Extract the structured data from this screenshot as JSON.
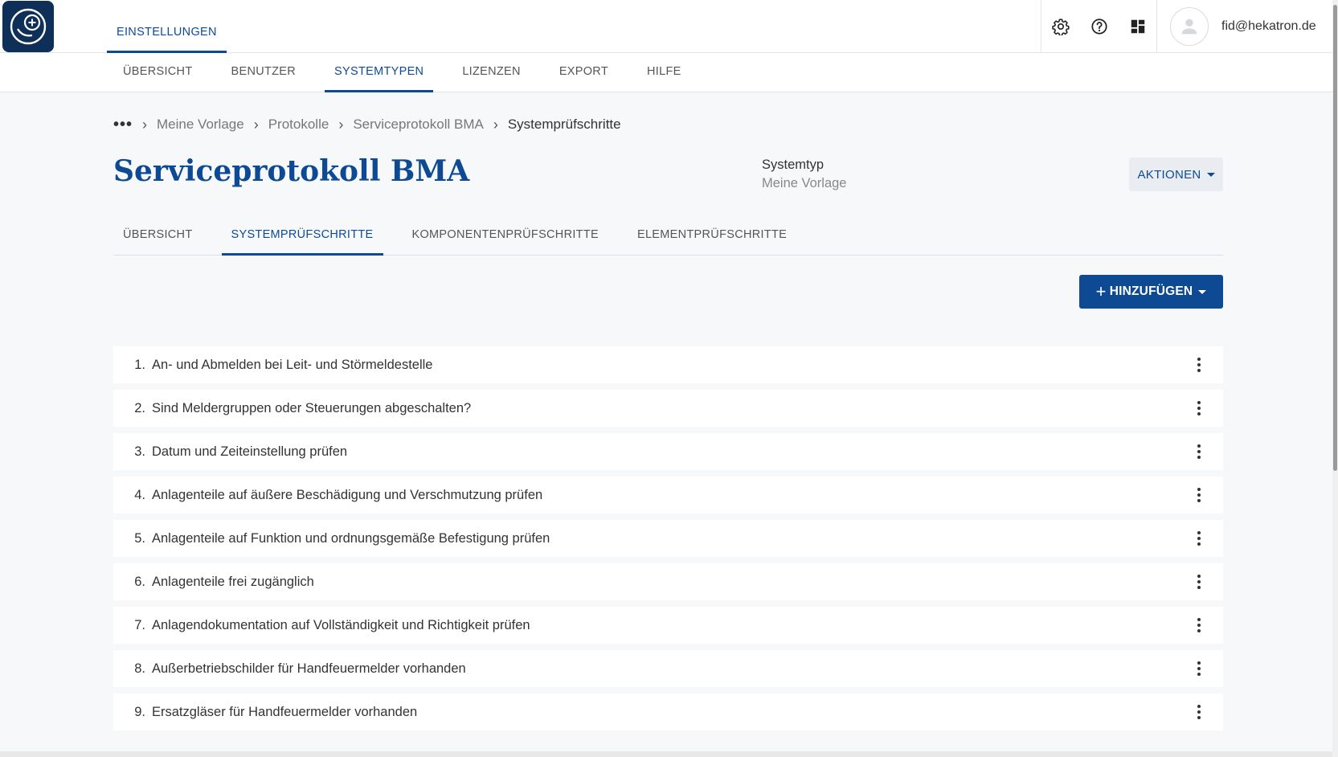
{
  "header": {
    "main_tab": "EINSTELLUNGEN",
    "user_email": "fid@hekatron.de"
  },
  "subnav": {
    "tabs": [
      "ÜBERSICHT",
      "BENUTZER",
      "SYSTEMTYPEN",
      "LIZENZEN",
      "EXPORT",
      "HILFE"
    ],
    "active": "SYSTEMTYPEN"
  },
  "breadcrumb": {
    "items": [
      "Meine Vorlage",
      "Protokolle",
      "Serviceprotokoll BMA"
    ],
    "current": "Systemprüfschritte"
  },
  "page": {
    "title": "Serviceprotokoll BMA",
    "meta_label": "Systemtyp",
    "meta_value": "Meine Vorlage",
    "actions_label": "AKTIONEN",
    "add_label": "HINZUFÜGEN"
  },
  "inner_tabs": {
    "tabs": [
      "ÜBERSICHT",
      "SYSTEMPRÜFSCHRITTE",
      "KOMPONENTENPRÜFSCHRITTE",
      "ELEMENTPRÜFSCHRITTE"
    ],
    "active": "SYSTEMPRÜFSCHRITTE"
  },
  "steps": [
    {
      "num": "1.",
      "text": "An- und Abmelden bei Leit- und Störmeldestelle"
    },
    {
      "num": "2.",
      "text": "Sind Meldergruppen oder Steuerungen abgeschalten?"
    },
    {
      "num": "3.",
      "text": "Datum und Zeiteinstellung prüfen"
    },
    {
      "num": "4.",
      "text": "Anlagenteile auf äußere Beschädigung und Verschmutzung prüfen"
    },
    {
      "num": "5.",
      "text": "Anlagenteile auf Funktion und ordnungsgemäße Befestigung prüfen"
    },
    {
      "num": "6.",
      "text": "Anlagenteile frei zugänglich"
    },
    {
      "num": "7.",
      "text": "Anlagendokumentation auf Vollständigkeit und Richtigkeit prüfen"
    },
    {
      "num": "8.",
      "text": "Außerbetriebschilder für Handfeuermelder vorhanden"
    },
    {
      "num": "9.",
      "text": "Ersatzgläser für Handfeuermelder vorhanden"
    }
  ],
  "colors": {
    "primary": "#0e4a94",
    "logo_bg": "#0e2f57"
  }
}
